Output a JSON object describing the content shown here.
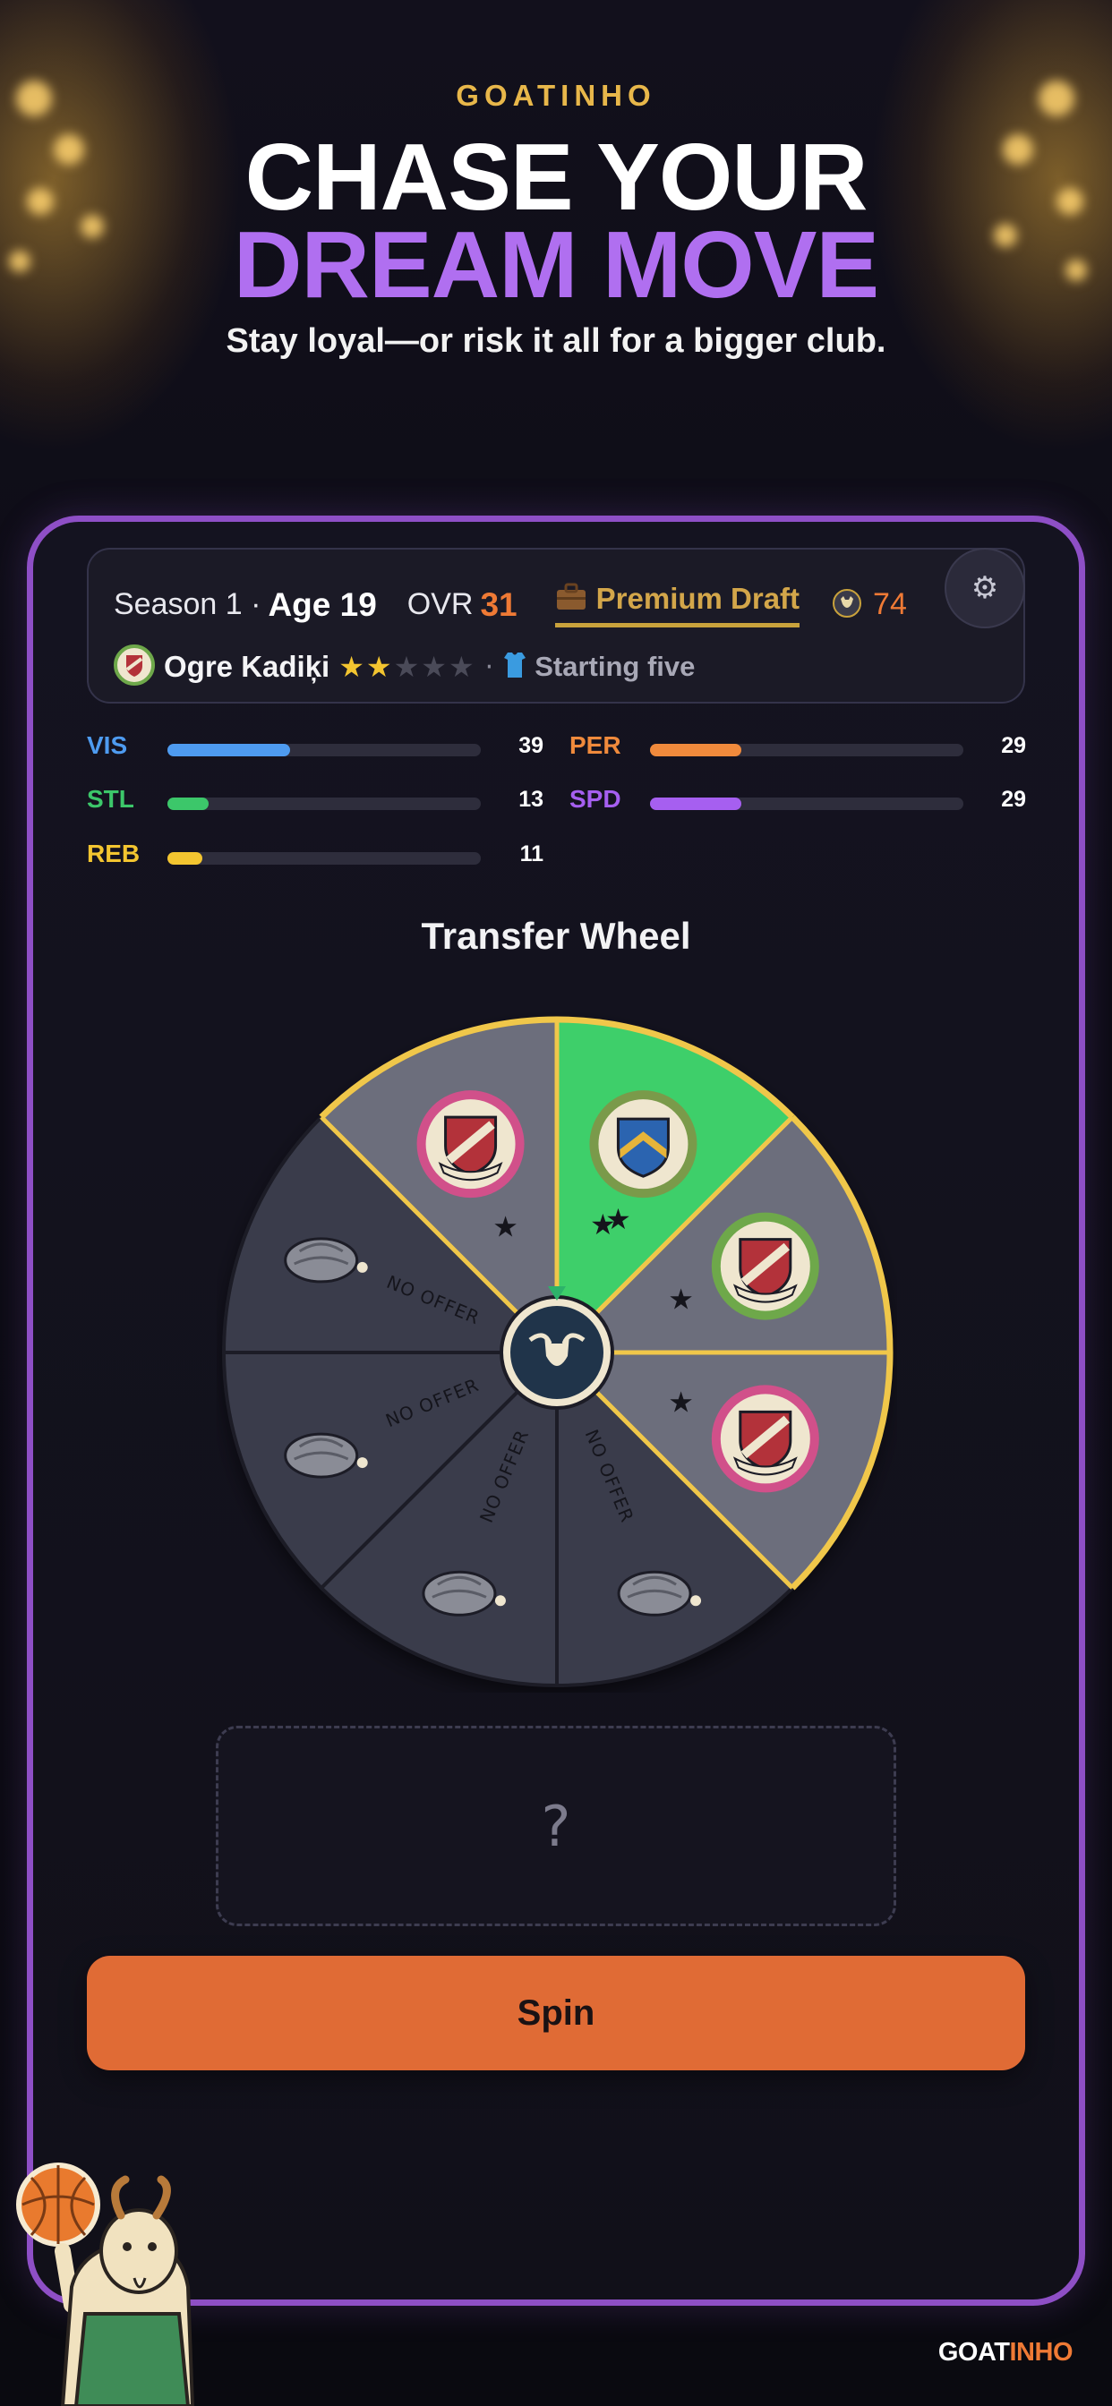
{
  "brand": {
    "top": "GOATINHO",
    "bottom_part1": "GOAT",
    "bottom_part2": "INHO"
  },
  "hero": {
    "line1": "CHASE YOUR",
    "line2": "DREAM MOVE",
    "subtitle": "Stay loyal—or risk it all for a bigger club."
  },
  "header": {
    "season": "Season 1 ·",
    "age": "Age 19",
    "ovr_label": "OVR",
    "ovr_value": "31",
    "draft_label": "Premium Draft",
    "coins": "74",
    "player_name": "Ogre Kadiķi",
    "stars_filled": 2,
    "stars_total": 5,
    "role": "Starting five",
    "icons": [
      "briefcase-icon",
      "goat-coin-icon",
      "gear-icon",
      "club-crest-icon",
      "jersey-icon"
    ]
  },
  "stats": [
    {
      "name": "VIS",
      "value": "39",
      "color": "#4e9bf0",
      "fraction": 0.39
    },
    {
      "name": "PER",
      "value": "29",
      "color": "#f08a3c",
      "fraction": 0.29
    },
    {
      "name": "STL",
      "value": "13",
      "color": "#3cc76a",
      "fraction": 0.13
    },
    {
      "name": "SPD",
      "value": "29",
      "color": "#a65ff0",
      "fraction": 0.29
    },
    {
      "name": "REB",
      "value": "11",
      "color": "#f3c530",
      "fraction": 0.11
    }
  ],
  "wheel": {
    "title": "Transfer Wheel",
    "segments": [
      {
        "type": "club",
        "stars": 2,
        "highlight": true,
        "ring": "#7a9a4a"
      },
      {
        "type": "club",
        "stars": 1,
        "ring": "#6ea84a"
      },
      {
        "type": "club",
        "stars": 1,
        "ring": "#d1508a"
      },
      {
        "type": "no_offer",
        "label": "NO OFFER"
      },
      {
        "type": "no_offer",
        "label": "NO OFFER"
      },
      {
        "type": "no_offer",
        "label": "NO OFFER"
      },
      {
        "type": "no_offer",
        "label": "NO OFFER"
      },
      {
        "type": "club",
        "stars": 1,
        "ring": "#d1508a"
      }
    ],
    "colors": {
      "highlight": "#3ecf6a",
      "club": "#6c6e7c",
      "no_offer": "#3a3c4b",
      "rim": "#f0c74a"
    }
  },
  "result": {
    "placeholder": "?"
  },
  "spin": {
    "label": "Spin"
  }
}
